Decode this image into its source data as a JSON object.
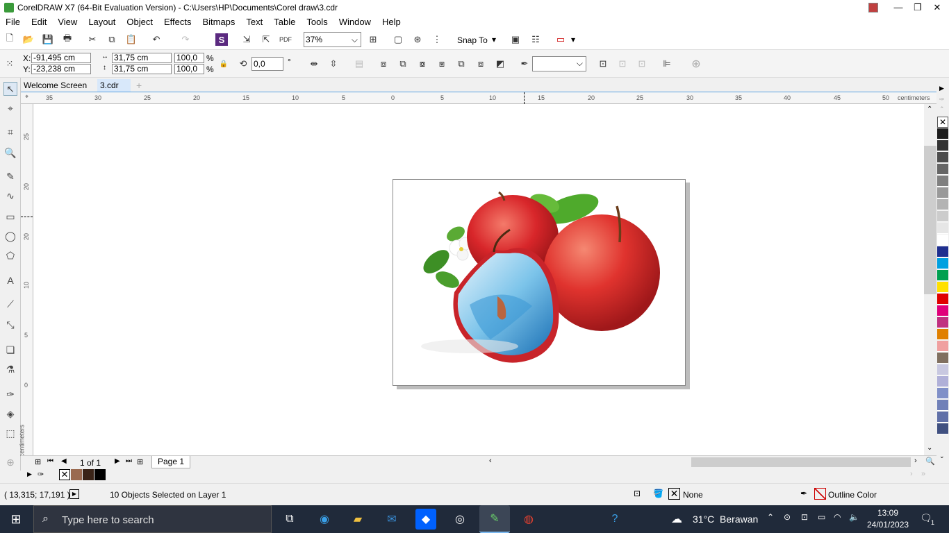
{
  "window": {
    "title": "CorelDRAW X7 (64-Bit Evaluation Version) - C:\\Users\\HP\\Documents\\Corel draw\\3.cdr"
  },
  "menu": [
    "File",
    "Edit",
    "View",
    "Layout",
    "Object",
    "Effects",
    "Bitmaps",
    "Text",
    "Table",
    "Tools",
    "Window",
    "Help"
  ],
  "toolbar": {
    "zoom": "37%",
    "snap_label": "Snap To"
  },
  "propbar": {
    "x_label": "X:",
    "x_value": "-91,495 cm",
    "y_label": "Y:",
    "y_value": "-23,238 cm",
    "w_value": "31,75 cm",
    "h_value": "31,75 cm",
    "scale_w": "100,0",
    "scale_h": "100,0",
    "percent": "%",
    "rotation": "0,0",
    "degree": "°"
  },
  "tabs": {
    "welcome": "Welcome Screen",
    "doc": "3.cdr"
  },
  "ruler": {
    "h_labels": [
      "35",
      "30",
      "25",
      "20",
      "15",
      "10",
      "5",
      "0",
      "5",
      "10",
      "15",
      "20",
      "25",
      "30",
      "35",
      "40",
      "45",
      "50"
    ],
    "h_unit": "centimeters",
    "v_labels": [
      "25",
      "20",
      "15",
      "10",
      "5",
      "0"
    ],
    "v_unit": "centimeters"
  },
  "pages": {
    "counter": "1 of 1",
    "page_tab": "Page 1"
  },
  "status": {
    "coords": "( 13,315; 17,191 )",
    "selection": "10 Objects Selected on Layer 1",
    "fill": "None",
    "outline": "Outline Color"
  },
  "taskbar": {
    "search_placeholder": "Type here to search",
    "weather": "31°C  Berawan",
    "time": "13:09",
    "date": "24/01/2023",
    "notif": "1"
  },
  "palette_colors": [
    "#ffffff",
    "#1c1c1c",
    "#333333",
    "#4d4d4d",
    "#666666",
    "#808080",
    "#999999",
    "#b3b3b3",
    "#cccccc",
    "#e6e6e6",
    "#ffffff",
    "#1f2f8f",
    "#00a0e0",
    "#00a050",
    "#ffe000",
    "#e00000",
    "#e0007a",
    "#c03080",
    "#e08000",
    "#f0a0a0",
    "#807060",
    "#c8c8e0",
    "#b0b0d8",
    "#8090c8",
    "#7080b8",
    "#6070a8",
    "#405080"
  ],
  "doc_palette": [
    "#9a6a50",
    "#3a2418",
    "#000000"
  ]
}
